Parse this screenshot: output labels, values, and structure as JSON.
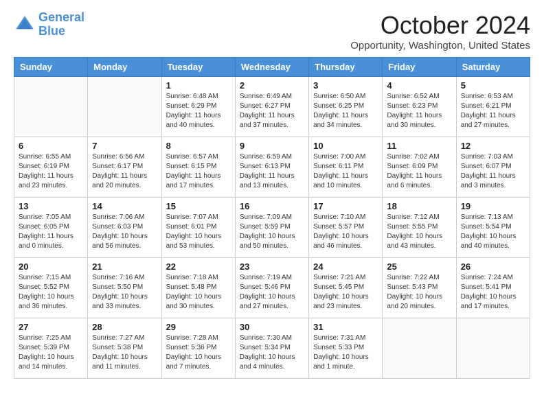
{
  "header": {
    "logo_line1": "General",
    "logo_line2": "Blue",
    "month_title": "October 2024",
    "location": "Opportunity, Washington, United States"
  },
  "days_of_week": [
    "Sunday",
    "Monday",
    "Tuesday",
    "Wednesday",
    "Thursday",
    "Friday",
    "Saturday"
  ],
  "weeks": [
    [
      {
        "day": "",
        "detail": ""
      },
      {
        "day": "",
        "detail": ""
      },
      {
        "day": "1",
        "detail": "Sunrise: 6:48 AM\nSunset: 6:29 PM\nDaylight: 11 hours and 40 minutes."
      },
      {
        "day": "2",
        "detail": "Sunrise: 6:49 AM\nSunset: 6:27 PM\nDaylight: 11 hours and 37 minutes."
      },
      {
        "day": "3",
        "detail": "Sunrise: 6:50 AM\nSunset: 6:25 PM\nDaylight: 11 hours and 34 minutes."
      },
      {
        "day": "4",
        "detail": "Sunrise: 6:52 AM\nSunset: 6:23 PM\nDaylight: 11 hours and 30 minutes."
      },
      {
        "day": "5",
        "detail": "Sunrise: 6:53 AM\nSunset: 6:21 PM\nDaylight: 11 hours and 27 minutes."
      }
    ],
    [
      {
        "day": "6",
        "detail": "Sunrise: 6:55 AM\nSunset: 6:19 PM\nDaylight: 11 hours and 23 minutes."
      },
      {
        "day": "7",
        "detail": "Sunrise: 6:56 AM\nSunset: 6:17 PM\nDaylight: 11 hours and 20 minutes."
      },
      {
        "day": "8",
        "detail": "Sunrise: 6:57 AM\nSunset: 6:15 PM\nDaylight: 11 hours and 17 minutes."
      },
      {
        "day": "9",
        "detail": "Sunrise: 6:59 AM\nSunset: 6:13 PM\nDaylight: 11 hours and 13 minutes."
      },
      {
        "day": "10",
        "detail": "Sunrise: 7:00 AM\nSunset: 6:11 PM\nDaylight: 11 hours and 10 minutes."
      },
      {
        "day": "11",
        "detail": "Sunrise: 7:02 AM\nSunset: 6:09 PM\nDaylight: 11 hours and 6 minutes."
      },
      {
        "day": "12",
        "detail": "Sunrise: 7:03 AM\nSunset: 6:07 PM\nDaylight: 11 hours and 3 minutes."
      }
    ],
    [
      {
        "day": "13",
        "detail": "Sunrise: 7:05 AM\nSunset: 6:05 PM\nDaylight: 11 hours and 0 minutes."
      },
      {
        "day": "14",
        "detail": "Sunrise: 7:06 AM\nSunset: 6:03 PM\nDaylight: 10 hours and 56 minutes."
      },
      {
        "day": "15",
        "detail": "Sunrise: 7:07 AM\nSunset: 6:01 PM\nDaylight: 10 hours and 53 minutes."
      },
      {
        "day": "16",
        "detail": "Sunrise: 7:09 AM\nSunset: 5:59 PM\nDaylight: 10 hours and 50 minutes."
      },
      {
        "day": "17",
        "detail": "Sunrise: 7:10 AM\nSunset: 5:57 PM\nDaylight: 10 hours and 46 minutes."
      },
      {
        "day": "18",
        "detail": "Sunrise: 7:12 AM\nSunset: 5:55 PM\nDaylight: 10 hours and 43 minutes."
      },
      {
        "day": "19",
        "detail": "Sunrise: 7:13 AM\nSunset: 5:54 PM\nDaylight: 10 hours and 40 minutes."
      }
    ],
    [
      {
        "day": "20",
        "detail": "Sunrise: 7:15 AM\nSunset: 5:52 PM\nDaylight: 10 hours and 36 minutes."
      },
      {
        "day": "21",
        "detail": "Sunrise: 7:16 AM\nSunset: 5:50 PM\nDaylight: 10 hours and 33 minutes."
      },
      {
        "day": "22",
        "detail": "Sunrise: 7:18 AM\nSunset: 5:48 PM\nDaylight: 10 hours and 30 minutes."
      },
      {
        "day": "23",
        "detail": "Sunrise: 7:19 AM\nSunset: 5:46 PM\nDaylight: 10 hours and 27 minutes."
      },
      {
        "day": "24",
        "detail": "Sunrise: 7:21 AM\nSunset: 5:45 PM\nDaylight: 10 hours and 23 minutes."
      },
      {
        "day": "25",
        "detail": "Sunrise: 7:22 AM\nSunset: 5:43 PM\nDaylight: 10 hours and 20 minutes."
      },
      {
        "day": "26",
        "detail": "Sunrise: 7:24 AM\nSunset: 5:41 PM\nDaylight: 10 hours and 17 minutes."
      }
    ],
    [
      {
        "day": "27",
        "detail": "Sunrise: 7:25 AM\nSunset: 5:39 PM\nDaylight: 10 hours and 14 minutes."
      },
      {
        "day": "28",
        "detail": "Sunrise: 7:27 AM\nSunset: 5:38 PM\nDaylight: 10 hours and 11 minutes."
      },
      {
        "day": "29",
        "detail": "Sunrise: 7:28 AM\nSunset: 5:36 PM\nDaylight: 10 hours and 7 minutes."
      },
      {
        "day": "30",
        "detail": "Sunrise: 7:30 AM\nSunset: 5:34 PM\nDaylight: 10 hours and 4 minutes."
      },
      {
        "day": "31",
        "detail": "Sunrise: 7:31 AM\nSunset: 5:33 PM\nDaylight: 10 hours and 1 minute."
      },
      {
        "day": "",
        "detail": ""
      },
      {
        "day": "",
        "detail": ""
      }
    ]
  ]
}
